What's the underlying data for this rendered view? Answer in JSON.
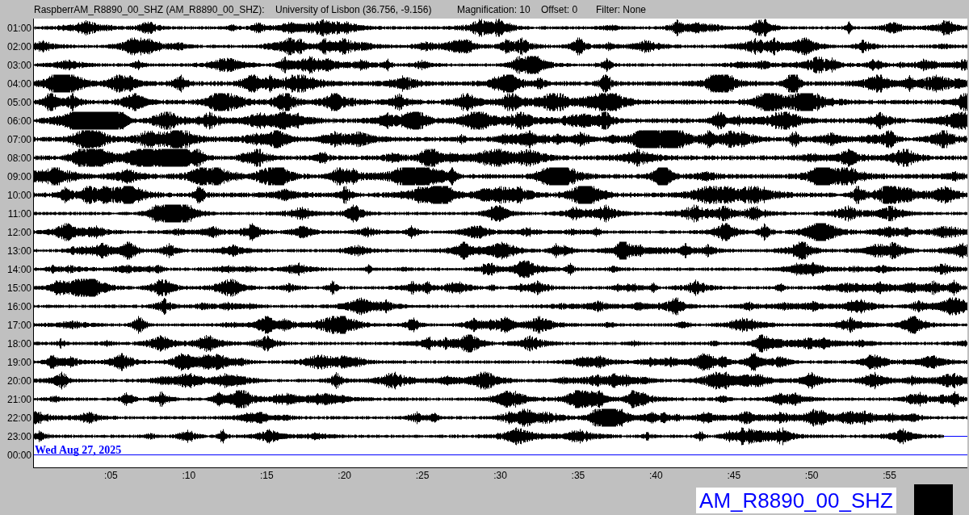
{
  "header": {
    "station": "RaspberrAM_R8890_00_SHZ (AM_R8890_00_SHZ):",
    "location": "University of Lisbon (36.756, -9.156)",
    "magnification": "Magnification: 10",
    "offset": "Offset: 0",
    "filter": "Filter: None"
  },
  "rows": [
    {
      "label": "01:00",
      "kind": "trace"
    },
    {
      "label": "02:00",
      "kind": "trace"
    },
    {
      "label": "03:00",
      "kind": "trace"
    },
    {
      "label": "04:00",
      "kind": "trace"
    },
    {
      "label": "05:00",
      "kind": "trace"
    },
    {
      "label": "06:00",
      "kind": "trace"
    },
    {
      "label": "07:00",
      "kind": "trace"
    },
    {
      "label": "08:00",
      "kind": "trace"
    },
    {
      "label": "09:00",
      "kind": "trace"
    },
    {
      "label": "10:00",
      "kind": "trace"
    },
    {
      "label": "11:00",
      "kind": "trace"
    },
    {
      "label": "12:00",
      "kind": "trace"
    },
    {
      "label": "13:00",
      "kind": "trace"
    },
    {
      "label": "14:00",
      "kind": "trace"
    },
    {
      "label": "15:00",
      "kind": "trace"
    },
    {
      "label": "16:00",
      "kind": "trace"
    },
    {
      "label": "17:00",
      "kind": "trace"
    },
    {
      "label": "18:00",
      "kind": "trace"
    },
    {
      "label": "19:00",
      "kind": "trace"
    },
    {
      "label": "20:00",
      "kind": "trace"
    },
    {
      "label": "21:00",
      "kind": "trace"
    },
    {
      "label": "22:00",
      "kind": "trace"
    },
    {
      "label": "23:00",
      "kind": "partial"
    },
    {
      "label": "00:00",
      "kind": "current"
    }
  ],
  "date": "Wed Aug 27, 2025",
  "x_ticks": [
    ":05",
    ":10",
    ":15",
    ":20",
    ":25",
    ":30",
    ":35",
    ":40",
    ":45",
    ":50",
    ":55"
  ],
  "station_label": "AM_R8890_00_SHZ"
}
